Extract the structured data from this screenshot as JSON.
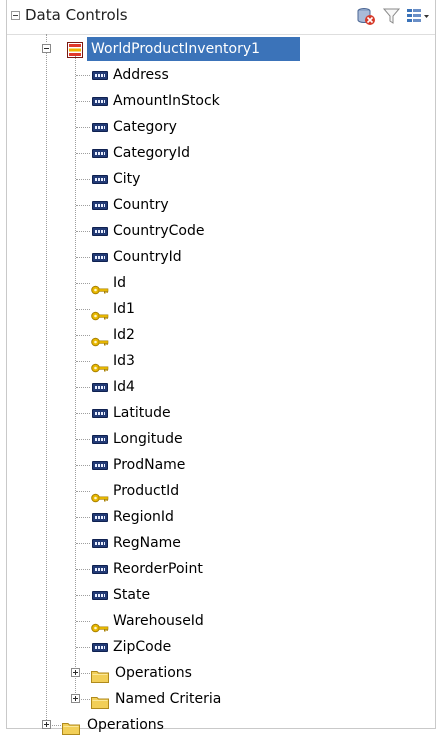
{
  "header": {
    "title": "Data Controls",
    "icons": [
      "delete-icon",
      "filter-icon",
      "options-menu-icon"
    ]
  },
  "tree": {
    "root_node": {
      "label": "WorldProductInventory1",
      "icon": "view-object-icon",
      "expanded": true,
      "selected": true
    },
    "attributes": [
      {
        "label": "Address",
        "icon": "attribute-icon"
      },
      {
        "label": "AmountInStock",
        "icon": "attribute-icon"
      },
      {
        "label": "Category",
        "icon": "attribute-icon"
      },
      {
        "label": "CategoryId",
        "icon": "attribute-icon"
      },
      {
        "label": "City",
        "icon": "attribute-icon"
      },
      {
        "label": "Country",
        "icon": "attribute-icon"
      },
      {
        "label": "CountryCode",
        "icon": "attribute-icon"
      },
      {
        "label": "CountryId",
        "icon": "attribute-icon"
      },
      {
        "label": "Id",
        "icon": "key-icon"
      },
      {
        "label": "Id1",
        "icon": "key-icon"
      },
      {
        "label": "Id2",
        "icon": "key-icon"
      },
      {
        "label": "Id3",
        "icon": "key-icon"
      },
      {
        "label": "Id4",
        "icon": "attribute-icon"
      },
      {
        "label": "Latitude",
        "icon": "attribute-icon"
      },
      {
        "label": "Longitude",
        "icon": "attribute-icon"
      },
      {
        "label": "ProdName",
        "icon": "attribute-icon"
      },
      {
        "label": "ProductId",
        "icon": "key-icon"
      },
      {
        "label": "RegionId",
        "icon": "attribute-icon"
      },
      {
        "label": "RegName",
        "icon": "attribute-icon"
      },
      {
        "label": "ReorderPoint",
        "icon": "attribute-icon"
      },
      {
        "label": "State",
        "icon": "attribute-icon"
      },
      {
        "label": "WarehouseId",
        "icon": "key-icon"
      },
      {
        "label": "ZipCode",
        "icon": "attribute-icon"
      }
    ],
    "child_folders": [
      {
        "label": "Operations",
        "icon": "folder-icon",
        "expanded": false
      },
      {
        "label": "Named Criteria",
        "icon": "folder-icon",
        "expanded": false
      }
    ],
    "top_folders": [
      {
        "label": "Operations",
        "icon": "folder-icon",
        "expanded": false
      }
    ]
  },
  "colors": {
    "selection": "#3b73b9",
    "attribute_icon": "#223a75",
    "key_icon": "#e8b800",
    "folder": "#f2cf58",
    "view_object_icon": "#e0392b"
  }
}
